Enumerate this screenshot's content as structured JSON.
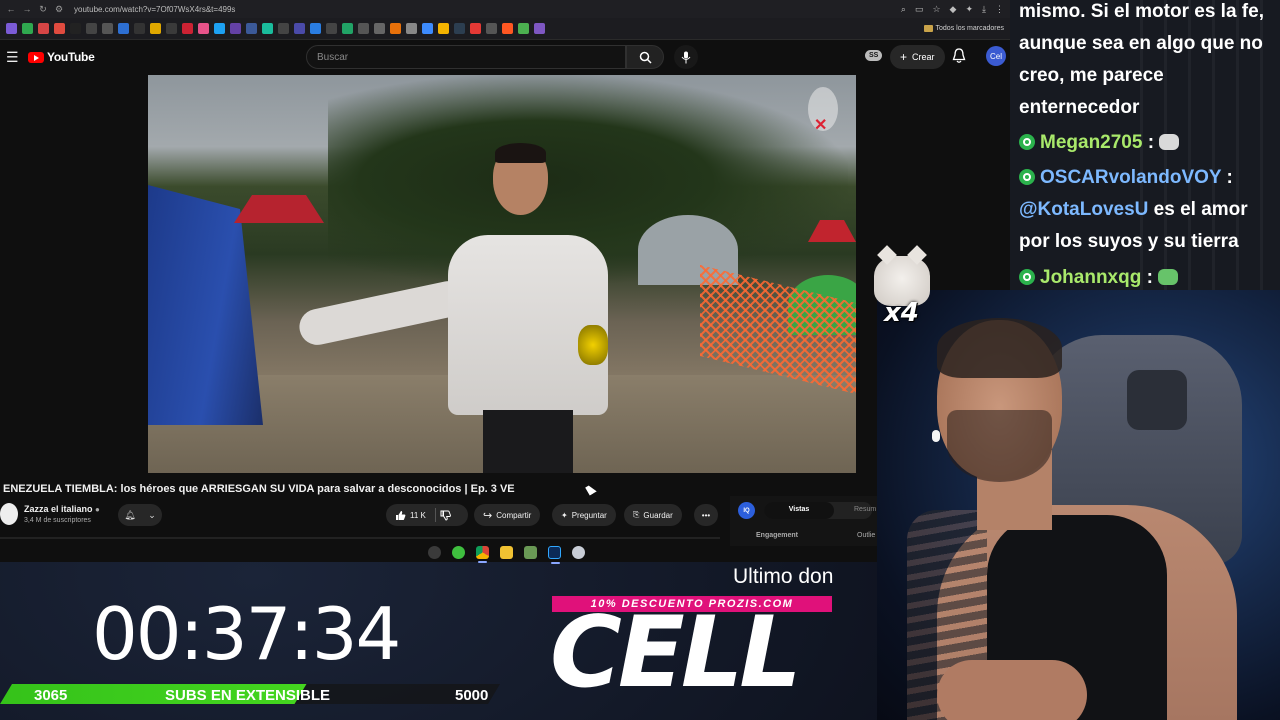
{
  "browser": {
    "url": "youtube.com/watch?v=7Of07WsX4rs&t=499s",
    "bookmarks_folder": "Todos los marcadores"
  },
  "youtube": {
    "logo_text": "YouTube",
    "search_placeholder": "Buscar",
    "create_label": "Crear",
    "ss_badge": "SS",
    "avatar_initials": "Cel"
  },
  "video": {
    "title": "ENEZUELA TIEMBLA: los héroes que ARRIESGAN SU VIDA para salvar a desconocidos | Ep. 3 VE",
    "channel_name": "Zazza el italiano",
    "channel_subs": "3,4 M de suscriptores",
    "likes": "11 K",
    "share_label": "Compartir",
    "ask_label": "Preguntar",
    "save_label": "Guardar"
  },
  "side_panel": {
    "iq_label": "IQ",
    "tab_active": "Vistas",
    "tab_other": "Resum",
    "engagement_label": "Engagement",
    "outlier_label": "Outlie"
  },
  "chat": {
    "messages": [
      {
        "text_line1": "mismo. Si el motor es la fe,",
        "text_line2": "aunque sea en algo que no",
        "text_line3": "creo, me parece",
        "text_line4": "enternecedor"
      },
      {
        "user": "Megan2705",
        "sep": ":"
      },
      {
        "user": "OSCARvolandoVOY",
        "sep": ":"
      },
      {
        "mention": "@KotaLovesU",
        "text_a": " es el amor",
        "text_b": "por los suyos y su tierra"
      },
      {
        "user": "Johannxqg",
        "sep": ":"
      }
    ]
  },
  "overlay": {
    "emote_multiplier": "x4",
    "timer": "00:37:34",
    "subs_current": "3065",
    "subs_label": "SUBS EN EXTENSIBLE",
    "subs_goal": "5000",
    "subs_progress": 0.613,
    "ticker_text": "Ultimo don",
    "promo_text": "10% DESCUENTO PROZIS.COM",
    "sponsor": "CELL"
  },
  "colors": {
    "youtube_red": "#ff0000",
    "progress_green": "#3fcf1c",
    "promo_pink": "#e0117a",
    "chat_username": "#a9e96b"
  }
}
